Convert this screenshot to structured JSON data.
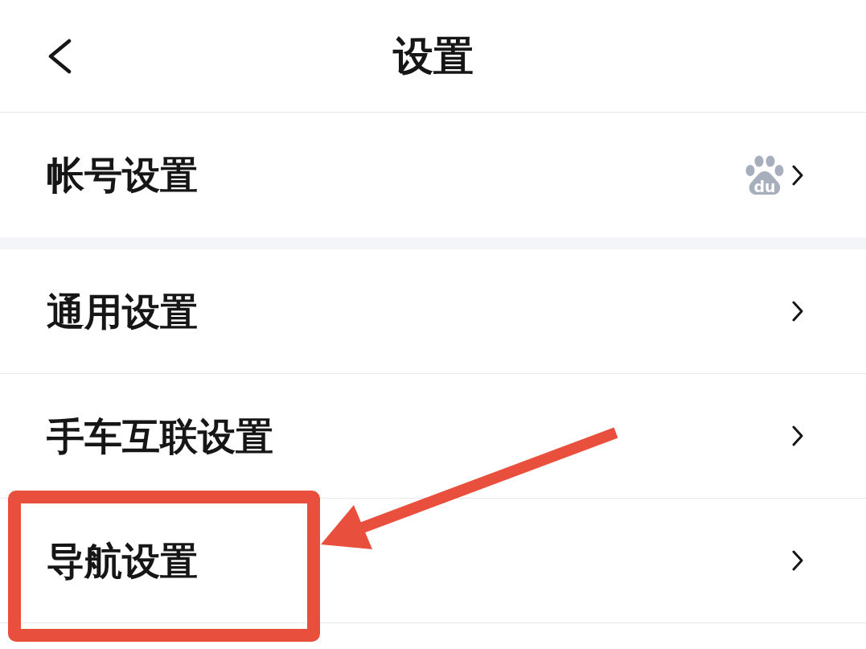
{
  "header": {
    "title": "设置"
  },
  "groups": [
    {
      "rows": [
        {
          "label": "帐号设置",
          "logo_text": "du",
          "highlighted": false
        }
      ]
    },
    {
      "rows": [
        {
          "label": "通用设置",
          "highlighted": false
        },
        {
          "label": "手车互联设置",
          "highlighted": false
        },
        {
          "label": "导航设置",
          "highlighted": true
        }
      ]
    }
  ]
}
